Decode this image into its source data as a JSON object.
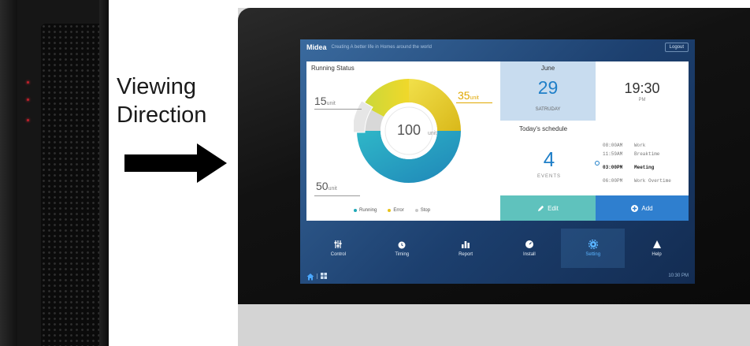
{
  "annotation": {
    "line1": "Viewing",
    "line2": "Direction"
  },
  "screen": {
    "brand": "Midea",
    "slogan": "Creating A better life in Homes around the world",
    "logout": "Logout",
    "running_status": {
      "title": "Running Status",
      "total": "100",
      "total_unit": "unit",
      "label_a": "15",
      "label_b": "35",
      "label_c": "50",
      "unit": "unit",
      "legend": [
        "Running",
        "Error",
        "Stop"
      ]
    },
    "date": {
      "month": "June",
      "day": "29",
      "weekday": "SATRUDAY"
    },
    "clock": {
      "time": "19:30",
      "ampm": "PM"
    },
    "schedule": {
      "title": "Today's schedule",
      "count": "4",
      "count_label": "EVENTS",
      "items": [
        {
          "time": "08:00AM",
          "name": "Work"
        },
        {
          "time": "11:59AM",
          "name": "Breaktime"
        },
        {
          "time": "03:00PM",
          "name": "Meeting"
        },
        {
          "time": "06:00PM",
          "name": "Work Overtime"
        }
      ]
    },
    "actions": {
      "edit": "Edit",
      "add": "Add"
    },
    "nav": [
      "Control",
      "Timing",
      "Report",
      "Install",
      "Setting",
      "Help"
    ],
    "footer_time": "10:30 PM"
  },
  "colors": {
    "running": "#1fa9b8",
    "error": "#e8c21a",
    "stop": "#c9c9c9",
    "accent_blue": "#1f7fc8",
    "edit": "#5fc2bd",
    "add": "#2f7fcf"
  }
}
